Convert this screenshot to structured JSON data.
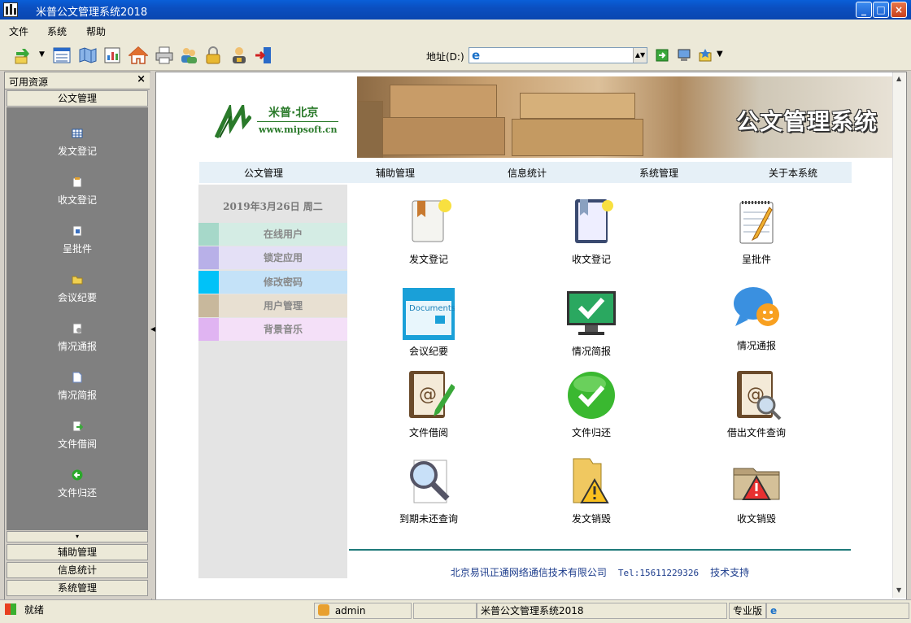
{
  "window": {
    "title": "米普公文管理系统2018"
  },
  "menu": [
    "文件",
    "系统",
    "帮助"
  ],
  "address": {
    "label": "地址(D:)",
    "value": ""
  },
  "left_panel": {
    "header": "可用资源",
    "close": "×",
    "active_tab": "公文管理",
    "items": [
      "发文登记",
      "收文登记",
      "呈批件",
      "会议纪要",
      "情况通报",
      "情况简报",
      "文件借阅",
      "文件归还"
    ],
    "scroll_down": "▾",
    "bottom_tabs": [
      "辅助管理",
      "信息统计",
      "系统管理"
    ]
  },
  "logo": {
    "name": "米普·北京",
    "url": "www.mipsoft.cn"
  },
  "banner": {
    "title": "公文管理系统"
  },
  "nav": [
    "公文管理",
    "辅助管理",
    "信息统计",
    "系统管理",
    "关于本系统"
  ],
  "side": {
    "date": "2019年3月26日  周二",
    "links": [
      "在线用户",
      "锁定应用",
      "修改密码",
      "用户管理",
      "背景音乐"
    ],
    "colors": [
      "#a6d8c9",
      "#b8b0e8",
      "#00c2f8",
      "#c8b89c",
      "#e0b4f2"
    ],
    "bg_colors": [
      "#d4ece4",
      "#e4e0f6",
      "#c4e2f8",
      "#e8e0d2",
      "#f4e0f8"
    ]
  },
  "grid": [
    "发文登记",
    "收文登记",
    "呈批件",
    "会议纪要",
    "情况简报",
    "情况通报",
    "文件借阅",
    "文件归还",
    "借出文件查询",
    "到期未还查询",
    "发文销毁",
    "收文销毁"
  ],
  "documents_text": "Documents",
  "footer": {
    "company": "北京易讯正通网络通信技术有限公司",
    "tel": "Tel:15611229326",
    "support": "技术支持"
  },
  "status": {
    "ready": "就绪",
    "user": "admin",
    "app": "米普公文管理系统2018",
    "edition": "专业版"
  }
}
